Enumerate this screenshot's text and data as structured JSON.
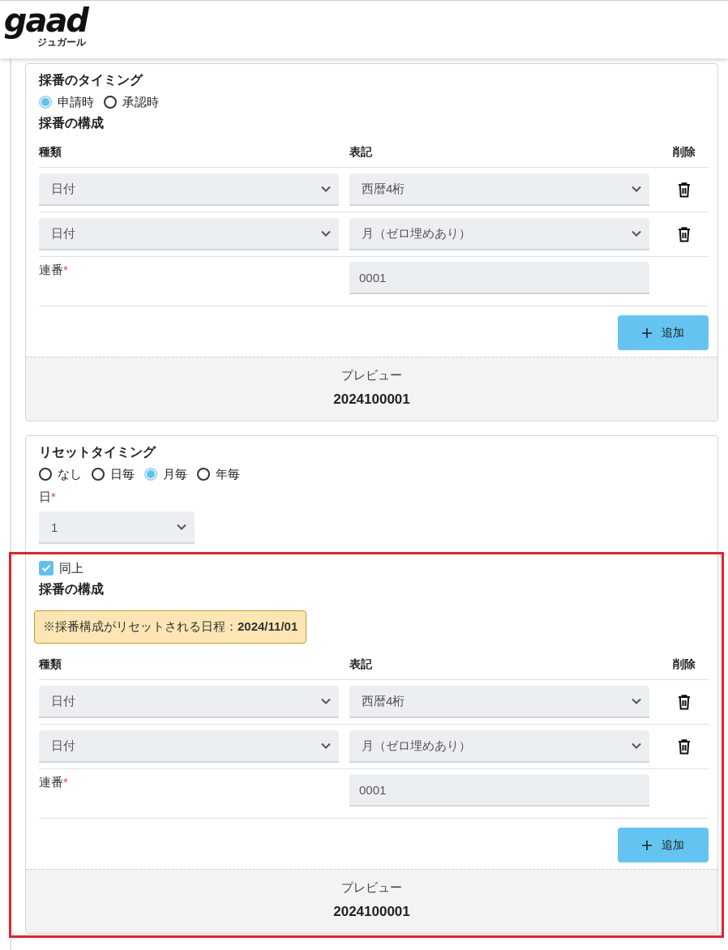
{
  "header": {
    "logo": "gaad",
    "logo_sub": "ジュガール"
  },
  "numbering_card": {
    "timing": {
      "title": "採番のタイミング",
      "options": [
        {
          "label": "申請時",
          "selected": true
        },
        {
          "label": "承認時",
          "selected": false
        }
      ]
    },
    "composition": {
      "title": "採番の構成",
      "columns": [
        "種類",
        "表記",
        "削除"
      ],
      "rows": [
        {
          "kind": "select",
          "type": "日付",
          "format": "西暦4桁"
        },
        {
          "kind": "select",
          "type": "日付",
          "format": "月（ゼロ埋めあり）"
        },
        {
          "kind": "serial",
          "label": "連番",
          "required_mark": "*",
          "value": "0001"
        }
      ],
      "add_button": "追加"
    },
    "preview": {
      "label": "プレビュー",
      "value": "2024100001"
    }
  },
  "reset_card": {
    "title": "リセットタイミング",
    "options": [
      {
        "label": "なし",
        "selected": false
      },
      {
        "label": "日毎",
        "selected": false
      },
      {
        "label": "月毎",
        "selected": true
      },
      {
        "label": "年毎",
        "selected": false
      }
    ],
    "day": {
      "label": "日",
      "required_mark": "*",
      "value": "1"
    },
    "same_as_above": {
      "label": "同上",
      "checked": true
    },
    "composition": {
      "title": "採番の構成",
      "notice": "※採番構成がリセットされる日程：**2024/11/01**",
      "columns": [
        "種類",
        "表記",
        "削除"
      ],
      "rows": [
        {
          "kind": "select",
          "type": "日付",
          "format": "西暦4桁"
        },
        {
          "kind": "select",
          "type": "日付",
          "format": "月（ゼロ埋めあり）"
        },
        {
          "kind": "serial",
          "label": "連番",
          "required_mark": "*",
          "value": "0001"
        }
      ],
      "add_button": "追加"
    },
    "preview": {
      "label": "プレビュー",
      "value": "2024100001"
    }
  }
}
